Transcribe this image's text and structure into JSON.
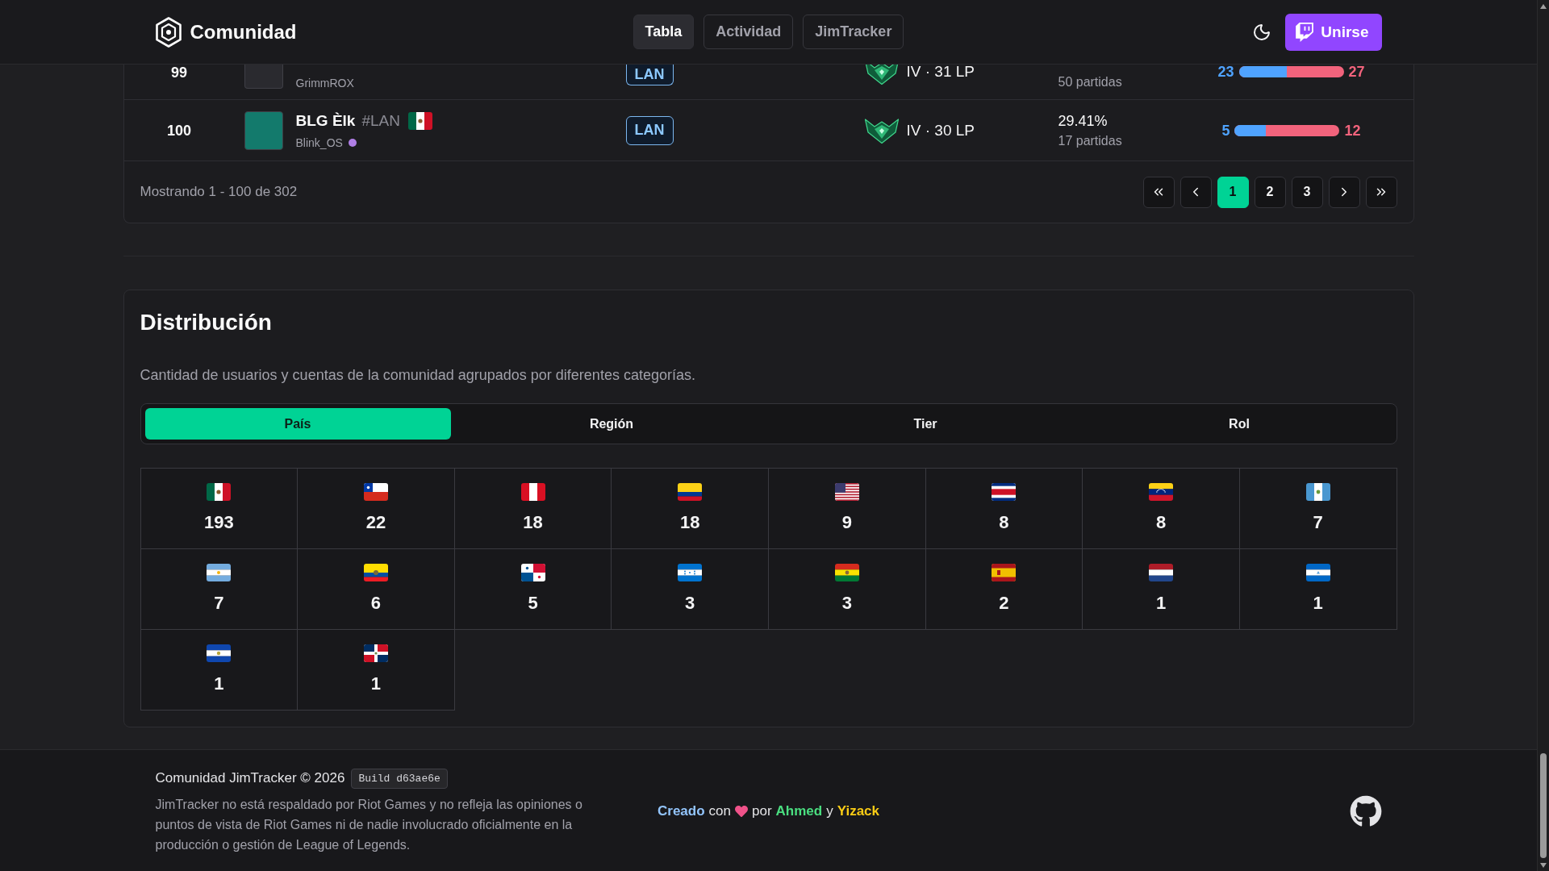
{
  "header": {
    "brand": "Comunidad",
    "nav": [
      {
        "label": "Tabla",
        "selected": true
      },
      {
        "label": "Actividad",
        "selected": false
      },
      {
        "label": "JimTracker",
        "selected": false
      }
    ],
    "join_button": "Unirse"
  },
  "table": {
    "rows": [
      {
        "kind": "clipped",
        "rank": "99",
        "avatar": {
          "color": "#2a2a2f"
        },
        "account": "GrimmROX",
        "region": "LAN",
        "tier": "IV · 31 LP",
        "games": "50 partidas",
        "wins": "23",
        "losses": "27",
        "level": 0.46
      },
      {
        "kind": "full",
        "rank": "100",
        "avatar": {
          "color": "#137a6c"
        },
        "name": "BLG Èlk",
        "tag": "#LAN",
        "flag": {
          "kind": "mx"
        },
        "account": "Blink_OS",
        "status": {
          "color": "#b07fe6"
        },
        "region": "LAN",
        "tier": "IV · 30 LP",
        "winrate": "29.41%",
        "games": "17 partidas",
        "wins": "5",
        "losses": "12",
        "level": 0.294
      }
    ],
    "summary": "Mostrando 1 - 100 de 302",
    "pages": [
      {
        "label": "1",
        "selected": true
      },
      {
        "label": "2",
        "selected": false
      },
      {
        "label": "3",
        "selected": false
      }
    ]
  },
  "distribution": {
    "title": "Distribución",
    "description": "Cantidad de usuarios y cuentas de la comunidad agrupados por diferentes categorías.",
    "tabs": [
      {
        "label": "País",
        "selected": true
      },
      {
        "label": "Región",
        "selected": false
      },
      {
        "label": "Tier",
        "selected": false
      },
      {
        "label": "Rol",
        "selected": false
      }
    ],
    "countries": [
      {
        "flag": {
          "kind": "mx"
        },
        "count": "193"
      },
      {
        "flag": {
          "kind": "cl"
        },
        "count": "22"
      },
      {
        "flag": {
          "kind": "pe"
        },
        "count": "18"
      },
      {
        "flag": {
          "kind": "co"
        },
        "count": "18"
      },
      {
        "flag": {
          "kind": "us"
        },
        "count": "9"
      },
      {
        "flag": {
          "kind": "cr"
        },
        "count": "8"
      },
      {
        "flag": {
          "kind": "ve"
        },
        "count": "8"
      },
      {
        "flag": {
          "kind": "gt"
        },
        "count": "7"
      },
      {
        "flag": {
          "kind": "ar"
        },
        "count": "7"
      },
      {
        "flag": {
          "kind": "ec"
        },
        "count": "6"
      },
      {
        "flag": {
          "kind": "pa"
        },
        "count": "5"
      },
      {
        "flag": {
          "kind": "hn"
        },
        "count": "3"
      },
      {
        "flag": {
          "kind": "bo"
        },
        "count": "3"
      },
      {
        "flag": {
          "kind": "es"
        },
        "count": "2"
      },
      {
        "flag": {
          "kind": "nl"
        },
        "count": "1"
      },
      {
        "flag": {
          "kind": "ni"
        },
        "count": "1"
      },
      {
        "flag": {
          "kind": "sv"
        },
        "count": "1"
      },
      {
        "flag": {
          "kind": "do"
        },
        "count": "1"
      }
    ]
  },
  "footer": {
    "copyright": "Comunidad JimTracker © 2026",
    "build": "Build d63ae6e",
    "disclaimer": "JimTracker no está respaldado por Riot Games y no refleja las opiniones o puntos de vista de Riot Games ni de nadie involucrado oficialmente en la producción o gestión de League of Legends.",
    "credits": [
      {
        "kind": "link",
        "text": "Creado",
        "color": "#93c5fd"
      },
      {
        "kind": "text",
        "text": "con"
      },
      {
        "kind": "heart"
      },
      {
        "kind": "text",
        "text": "por"
      },
      {
        "kind": "link",
        "text": "Ahmed",
        "color": "#4ade80"
      },
      {
        "kind": "text",
        "text": "y"
      },
      {
        "kind": "link",
        "text": "Yizack",
        "color": "#facc15"
      }
    ]
  }
}
